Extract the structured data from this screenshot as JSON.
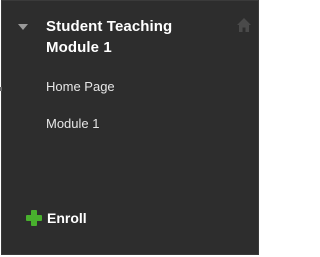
{
  "course_menu": {
    "title": "Student Teaching Module 1",
    "items": [
      {
        "label": "Home Page"
      },
      {
        "label": "Module 1"
      }
    ],
    "enroll_label": "Enroll",
    "icons": {
      "collapse": "chevron-down-icon",
      "home": "home-icon",
      "enroll": "plus-icon"
    },
    "colors": {
      "background": "#2d2d2d",
      "text": "#ffffff",
      "accent_green": "#48b02d",
      "muted_icon": "#4a4a4a"
    }
  }
}
